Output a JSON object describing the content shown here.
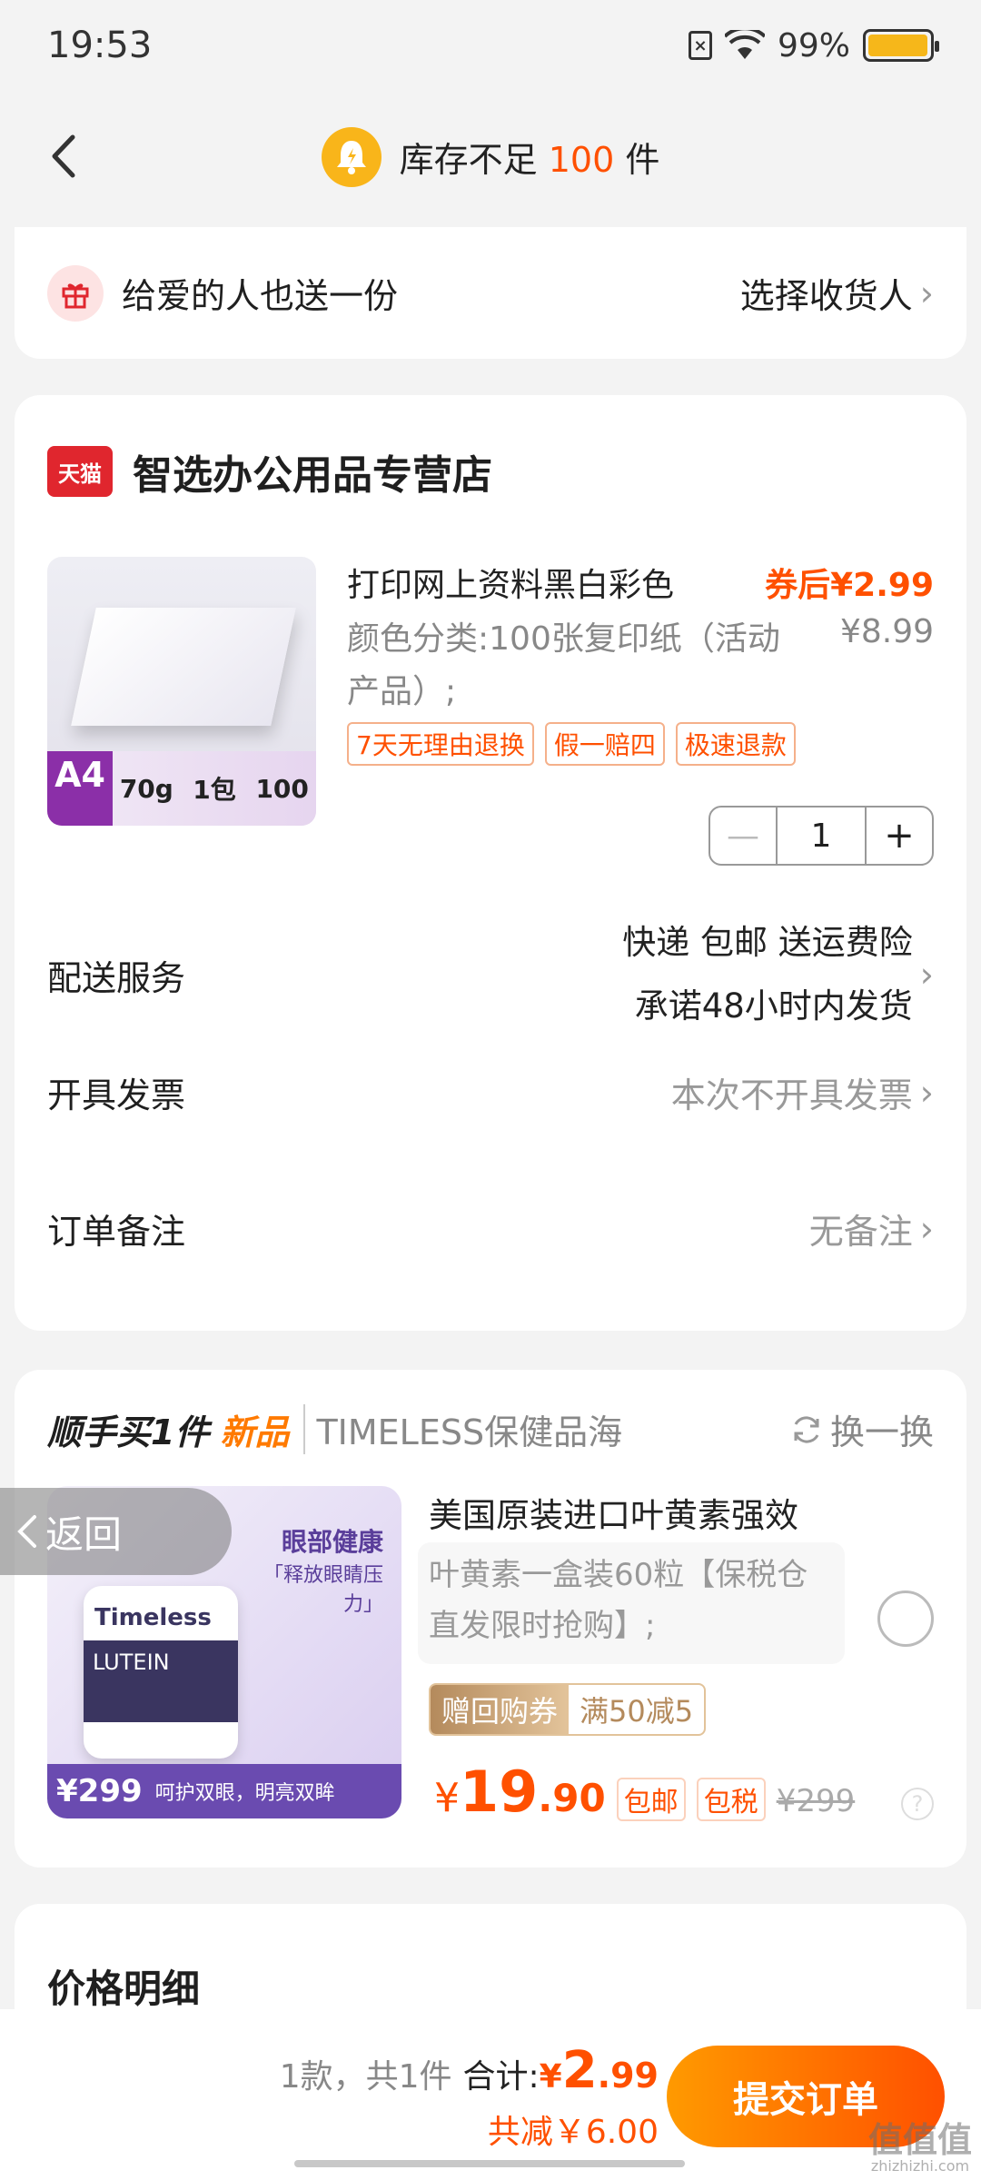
{
  "status": {
    "time": "19:53",
    "battery": "99%",
    "battery_level": 0.99
  },
  "header": {
    "notice_prefix": "库存不足",
    "notice_number": "100",
    "notice_suffix": "件"
  },
  "gift": {
    "label": "给爱的人也送一份",
    "action": "选择收货人"
  },
  "store": {
    "platform_badge": "天猫",
    "name": "智选办公用品专营店",
    "product": {
      "title": "打印网上资料黑白彩色",
      "price_after_coupon": "券后¥2.99",
      "sku": "颜色分类:100张复印纸（活动产品）;",
      "original_price": "¥8.99",
      "thumb_badge": "A4",
      "thumb_specs": [
        "70g",
        "1包",
        "100"
      ],
      "tags": [
        "7天无理由退换",
        "假一赔四",
        "极速退款"
      ],
      "quantity": "1"
    },
    "delivery": {
      "label": "配送服务",
      "line1": "快递 包邮 送运费险",
      "line2": "承诺48小时内发货"
    },
    "invoice": {
      "label": "开具发票",
      "value": "本次不开具发票"
    },
    "note": {
      "label": "订单备注",
      "value": "无备注"
    }
  },
  "addon": {
    "label_a": "顺手买1件",
    "label_b": "新品",
    "brand": "TIMELESS保健品海",
    "swap": "换一换",
    "thumb_brand": "Timeless",
    "thumb_product": "LUTEIN",
    "thumb_eye_title": "眼部健康",
    "thumb_eye_sub": "「释放眼睛压力」",
    "thumb_price": "299",
    "thumb_slogan": "呵护双眼，明亮双眸",
    "title": "美国原装进口叶黄素强效",
    "desc": "叶黄素一盒装60粒【保税仓直发限时抢购】;",
    "coupon_label": "赠回购券",
    "coupon_value": "满50减5",
    "price_symbol": "¥",
    "price_int": "19",
    "price_dec": ".90",
    "tag1": "包邮",
    "tag2": "包税",
    "old_price": "¥299"
  },
  "float_back": "返回",
  "detail": {
    "title": "价格明细"
  },
  "bottom": {
    "count": "1款，共1件",
    "total_label": "合计:",
    "total_symbol": "¥",
    "total_int": "2",
    "total_dec": ".99",
    "saved": "共减￥6.00",
    "submit": "提交订单"
  },
  "watermark": {
    "main": "值值值",
    "sub": "zhizhizhi.com"
  }
}
